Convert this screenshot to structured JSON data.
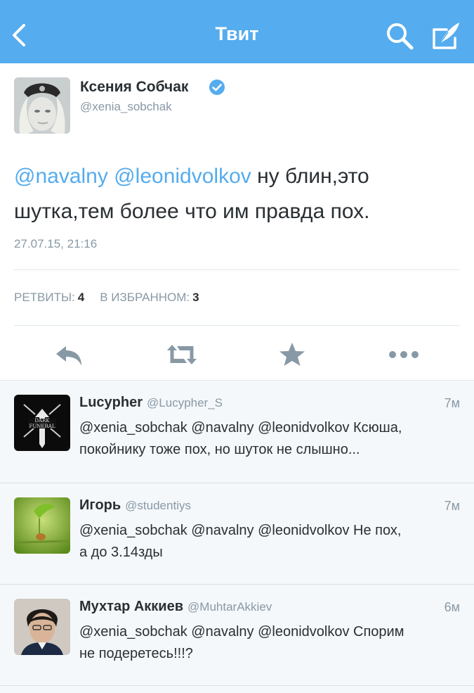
{
  "header": {
    "title": "Твит"
  },
  "tweet": {
    "author_name": "Ксения Собчак",
    "author_handle": "@xenia_sobchak",
    "mention1": "@navalny",
    "mention2": "@leonidvolkov",
    "text_line1": " ну блин,это",
    "text_line2": "шутка,тем более что им правда пох.",
    "date": "27.07.15, 21:16",
    "retweets_label": "РЕТВИТЫ:",
    "retweets_count": "4",
    "favorites_label": "В ИЗБРАННОМ:",
    "favorites_count": "3"
  },
  "actions": [
    "reply-icon",
    "retweet-icon",
    "favorite-icon",
    "more-icon"
  ],
  "colors": {
    "accent": "#55acee",
    "muted": "#8899a6",
    "text": "#292f33"
  },
  "replies": [
    {
      "name": "Lucypher",
      "handle": "@Lucypher_S",
      "time": "7м",
      "line1": "@xenia_sobchak @navalny @leonidvolkov Ксюша,",
      "line2": "покойнику тоже пох, но шуток не слышно..."
    },
    {
      "name": "Игорь",
      "handle": "@studentiys",
      "time": "7м",
      "line1": "@xenia_sobchak @navalny @leonidvolkov Не пох,",
      "line2": "а до 3.14зды"
    },
    {
      "name": "Мухтар Аккиев",
      "handle": "@MuhtarAkkiev",
      "time": "6м",
      "line1": "@xenia_sobchak @navalny @leonidvolkov Спорим",
      "line2": "не подеретесь!!!?"
    }
  ]
}
